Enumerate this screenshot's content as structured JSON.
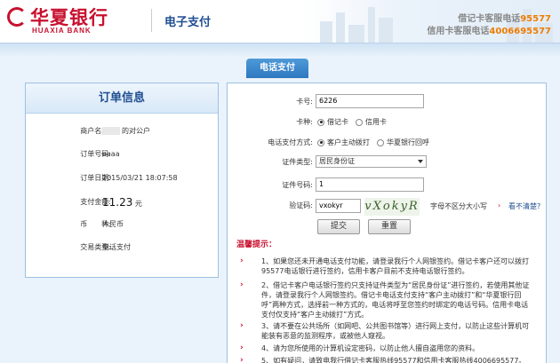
{
  "header": {
    "bank_name_cn": "华夏银行",
    "bank_name_en": "HUAXIA BANK",
    "page_title": "电子支付",
    "hotline_debit_label": "借记卡客服电话",
    "hotline_debit_number": "95577",
    "hotline_credit_label": "信用卡客服电话",
    "hotline_credit_number": "4006695577"
  },
  "tab": {
    "label": "电话支付"
  },
  "order": {
    "title": "订单信息",
    "rows": [
      {
        "label": "商户名称:",
        "value": "的对公户"
      },
      {
        "label": "订单号码:",
        "value": "aaaa"
      },
      {
        "label": "订单日期:",
        "value": "2015/03/21 18:07:58"
      },
      {
        "label": "支付金额:",
        "value": "11.23",
        "unit": "元"
      },
      {
        "label": "币　　种:",
        "value": "人民币"
      },
      {
        "label": "交易类型:",
        "value": "电话支付"
      }
    ]
  },
  "form": {
    "card_no_label": "卡号:",
    "card_no_value": "6226",
    "card_type_label": "卡种:",
    "card_type_debit": "借记卡",
    "card_type_credit": "信用卡",
    "method_label": "电话支付方式:",
    "method_customer": "客户主动拨打",
    "method_bank": "华夏银行回呼",
    "id_type_label": "证件类型:",
    "id_type_value": "居民身份证",
    "id_no_label": "证件号码:",
    "id_no_value": "1",
    "captcha_label": "验证码:",
    "captcha_value": "vxokyr",
    "captcha_image_text": "vXokyR",
    "captcha_hint": "字母不区分大小写",
    "captcha_refresh": "看不清楚?",
    "submit_label": "提交",
    "reset_label": "重置"
  },
  "tips": {
    "title": "温馨提示：",
    "items": [
      "1、如果您还未开通电话支付功能，请登录我行个人网银签约。借记卡客户还可以拨打95577电话银行进行签约，信用卡客户目前不支持电话银行签约。",
      "2、借记卡客户电话银行签约只支持证件类型为“居民身份证”进行签约，若使用其他证件，请登录我行个人网银签约。借记卡电话支付支持“客户主动拨打”和“华夏银行回呼”两种方式，选择前一种方式的，电话将呼至您签约时绑定的电话号码。信用卡电话支付仅支持“客户主动拨打”方式。",
      "3、请不要在公共场所（如网吧、公共图书馆等）进行网上支付，以防止这些计算机可能装有恶意的监测程序，或被他人窥视。",
      "4、请为您所使用的计算机设定密码，以防止他人擅自盗用您的资料。",
      "5、如有疑问，请致电我行借记卡客服热线95577和信用卡客服热线4006695577。"
    ]
  }
}
